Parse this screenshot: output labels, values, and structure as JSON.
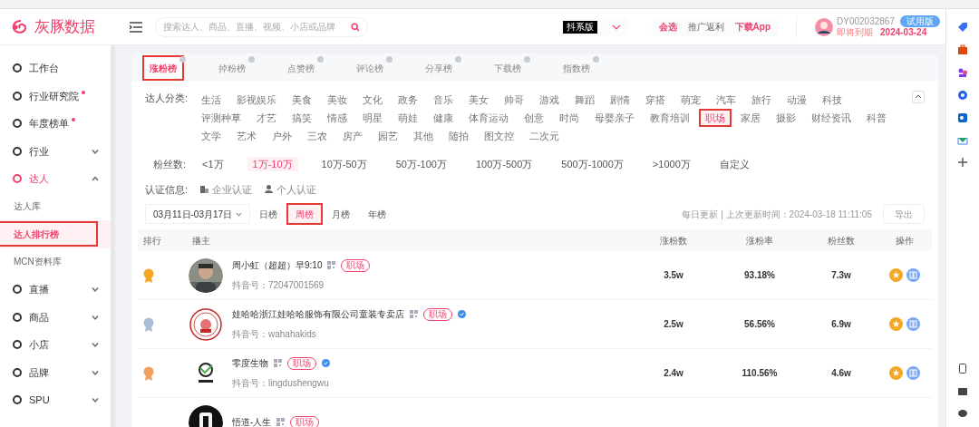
{
  "header": {
    "logo_text": "灰豚数据",
    "search": {
      "placeholder": "搜索达人、商品、直播、视频、小店或品牌"
    },
    "version": "抖系版",
    "links": [
      {
        "label": "会选",
        "kind": "brand"
      },
      {
        "label": "推广返利",
        "kind": "plain"
      },
      {
        "label": "下载App",
        "kind": "brand"
      }
    ],
    "user": {
      "id": "DY002032867",
      "badge": "试用版",
      "expiry_label": "即将到期",
      "expiry_date": "2024-03-24"
    }
  },
  "sidebar": {
    "items": [
      {
        "label": "工作台",
        "dot": false,
        "selected": false
      },
      {
        "label": "行业研究院",
        "dot": true,
        "selected": false
      },
      {
        "label": "年度榜单",
        "dot": true,
        "selected": false
      },
      {
        "label": "行业",
        "dot": false,
        "selected": false,
        "expanded": false
      },
      {
        "label": "达人",
        "dot": false,
        "selected": true,
        "expanded": true,
        "children": [
          {
            "label": "达人库",
            "selected": false,
            "marked": false
          },
          {
            "label": "达人排行榜",
            "selected": true,
            "marked": true
          },
          {
            "label": "MCN资料库",
            "selected": false,
            "marked": false
          }
        ]
      },
      {
        "label": "直播",
        "dot": false,
        "selected": false,
        "expanded": false
      },
      {
        "label": "商品",
        "dot": false,
        "selected": false,
        "expanded": false
      },
      {
        "label": "小店",
        "dot": false,
        "selected": false,
        "expanded": false
      },
      {
        "label": "品牌",
        "dot": false,
        "selected": false,
        "expanded": false
      },
      {
        "label": "SPU",
        "dot": false,
        "selected": false,
        "expanded": false
      }
    ]
  },
  "tabs": [
    {
      "label": "涨粉榜",
      "selected": true,
      "marked": true
    },
    {
      "label": "掉粉榜",
      "selected": false,
      "marked": false
    },
    {
      "label": "点赞榜",
      "selected": false,
      "marked": false
    },
    {
      "label": "评论榜",
      "selected": false,
      "marked": false
    },
    {
      "label": "分享榜",
      "selected": false,
      "marked": false
    },
    {
      "label": "下载榜",
      "selected": false,
      "marked": false
    },
    {
      "label": "指数榜",
      "selected": false,
      "marked": false
    }
  ],
  "filters": {
    "category_label": "达人分类:",
    "categories": [
      {
        "label": "生活",
        "selected": false,
        "marked": false
      },
      {
        "label": "影视娱乐",
        "selected": false,
        "marked": false
      },
      {
        "label": "美食",
        "selected": false,
        "marked": false
      },
      {
        "label": "美妆",
        "selected": false,
        "marked": false
      },
      {
        "label": "文化",
        "selected": false,
        "marked": false
      },
      {
        "label": "政务",
        "selected": false,
        "marked": false
      },
      {
        "label": "音乐",
        "selected": false,
        "marked": false
      },
      {
        "label": "美女",
        "selected": false,
        "marked": false
      },
      {
        "label": "帅哥",
        "selected": false,
        "marked": false
      },
      {
        "label": "游戏",
        "selected": false,
        "marked": false
      },
      {
        "label": "舞蹈",
        "selected": false,
        "marked": false
      },
      {
        "label": "剧情",
        "selected": false,
        "marked": false
      },
      {
        "label": "穿搭",
        "selected": false,
        "marked": false
      },
      {
        "label": "萌宠",
        "selected": false,
        "marked": false
      },
      {
        "label": "汽车",
        "selected": false,
        "marked": false
      },
      {
        "label": "旅行",
        "selected": false,
        "marked": false
      },
      {
        "label": "动漫",
        "selected": false,
        "marked": false
      },
      {
        "label": "科技",
        "selected": false,
        "marked": false
      },
      {
        "label": "评测种草",
        "selected": false,
        "marked": false
      },
      {
        "label": "才艺",
        "selected": false,
        "marked": false
      },
      {
        "label": "搞笑",
        "selected": false,
        "marked": false
      },
      {
        "label": "情感",
        "selected": false,
        "marked": false
      },
      {
        "label": "明星",
        "selected": false,
        "marked": false
      },
      {
        "label": "萌娃",
        "selected": false,
        "marked": false
      },
      {
        "label": "健康",
        "selected": false,
        "marked": false
      },
      {
        "label": "体育运动",
        "selected": false,
        "marked": false
      },
      {
        "label": "创意",
        "selected": false,
        "marked": false
      },
      {
        "label": "时尚",
        "selected": false,
        "marked": false
      },
      {
        "label": "母婴亲子",
        "selected": false,
        "marked": false
      },
      {
        "label": "教育培训",
        "selected": false,
        "marked": false
      },
      {
        "label": "职场",
        "selected": true,
        "marked": true
      },
      {
        "label": "家居",
        "selected": false,
        "marked": false
      },
      {
        "label": "摄影",
        "selected": false,
        "marked": false
      },
      {
        "label": "财经资讯",
        "selected": false,
        "marked": false
      },
      {
        "label": "科普",
        "selected": false,
        "marked": false
      },
      {
        "label": "文学",
        "selected": false,
        "marked": false
      },
      {
        "label": "艺术",
        "selected": false,
        "marked": false
      },
      {
        "label": "户外",
        "selected": false,
        "marked": false
      },
      {
        "label": "三农",
        "selected": false,
        "marked": false
      },
      {
        "label": "房产",
        "selected": false,
        "marked": false
      },
      {
        "label": "园艺",
        "selected": false,
        "marked": false
      },
      {
        "label": "其他",
        "selected": false,
        "marked": false
      },
      {
        "label": "随拍",
        "selected": false,
        "marked": false
      },
      {
        "label": "图文控",
        "selected": false,
        "marked": false
      },
      {
        "label": "二次元",
        "selected": false,
        "marked": false
      }
    ],
    "fans_label": "粉丝数:",
    "fans": [
      {
        "label": "<1万",
        "selected": false
      },
      {
        "label": "1万-10万",
        "selected": true
      },
      {
        "label": "10万-50万",
        "selected": false
      },
      {
        "label": "50万-100万",
        "selected": false
      },
      {
        "label": "100万-500万",
        "selected": false
      },
      {
        "label": "500万-1000万",
        "selected": false
      },
      {
        "label": ">1000万",
        "selected": false
      },
      {
        "label": "自定义",
        "selected": false
      }
    ],
    "auth_label": "认证信息:",
    "auth": [
      {
        "label": "企业认证",
        "kind": "company"
      },
      {
        "label": "个人认证",
        "kind": "person"
      }
    ],
    "date_range": "03月11日-03月17日",
    "periods": [
      {
        "label": "日榜",
        "selected": false,
        "marked": false
      },
      {
        "label": "周榜",
        "selected": true,
        "marked": true
      },
      {
        "label": "月榜",
        "selected": false,
        "marked": false
      },
      {
        "label": "年榜",
        "selected": false,
        "marked": false
      }
    ],
    "update_text": "每日更新 | 上次更新时间：2024-03-18 11:11:05",
    "export": "导出"
  },
  "table": {
    "columns": [
      "排行",
      "播主",
      "涨粉数",
      "涨粉率",
      "粉丝数",
      "操作"
    ],
    "rows": [
      {
        "color": "#f5a623",
        "name": "周小虹（超超）早9:10",
        "tag": "职场",
        "verified": false,
        "account": "抖音号：72047001569",
        "gain": "3.5w",
        "rate": "93.18%",
        "fans": "7.3w"
      },
      {
        "color": "#a9bfd6",
        "name": "娃哈哈浙江娃哈哈服饰有限公司童装专卖店",
        "tag": "职场",
        "verified": true,
        "account": "抖音号：wahahakids",
        "gain": "2.5w",
        "rate": "56.56%",
        "fans": "6.9w"
      },
      {
        "color": "#f0a060",
        "name": "零度生物",
        "tag": "职场",
        "verified": true,
        "account": "抖音号：lingdushengwu",
        "gain": "2.4w",
        "rate": "110.56%",
        "fans": "4.6w"
      },
      {
        "name": "悟道-人生",
        "tag": "职场",
        "verified": false
      }
    ]
  }
}
